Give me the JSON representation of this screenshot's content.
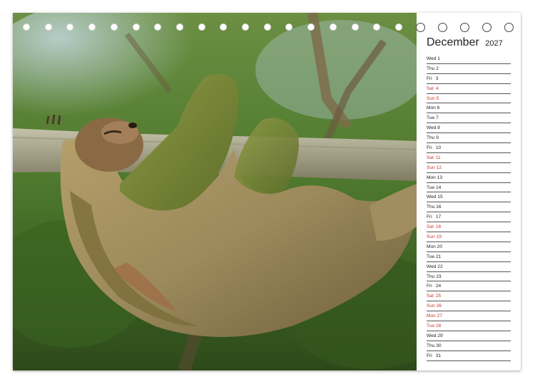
{
  "calendar": {
    "month": "December",
    "year": "2027",
    "weekend_color": "#c0392b",
    "days": [
      {
        "wd": "Wed",
        "d": "1",
        "weekend": false
      },
      {
        "wd": "Thu",
        "d": "2",
        "weekend": false
      },
      {
        "wd": "Fri",
        "d": "3",
        "weekend": false
      },
      {
        "wd": "Sat",
        "d": "4",
        "weekend": true
      },
      {
        "wd": "Sun",
        "d": "5",
        "weekend": true
      },
      {
        "wd": "Mon",
        "d": "6",
        "weekend": false
      },
      {
        "wd": "Tue",
        "d": "7",
        "weekend": false
      },
      {
        "wd": "Wed",
        "d": "8",
        "weekend": false
      },
      {
        "wd": "Thu",
        "d": "9",
        "weekend": false
      },
      {
        "wd": "Fri",
        "d": "10",
        "weekend": false
      },
      {
        "wd": "Sat",
        "d": "11",
        "weekend": true
      },
      {
        "wd": "Sun",
        "d": "12",
        "weekend": true
      },
      {
        "wd": "Mon",
        "d": "13",
        "weekend": false
      },
      {
        "wd": "Tue",
        "d": "14",
        "weekend": false
      },
      {
        "wd": "Wed",
        "d": "15",
        "weekend": false
      },
      {
        "wd": "Thu",
        "d": "16",
        "weekend": false
      },
      {
        "wd": "Fri",
        "d": "17",
        "weekend": false
      },
      {
        "wd": "Sat",
        "d": "18",
        "weekend": true
      },
      {
        "wd": "Sun",
        "d": "19",
        "weekend": true
      },
      {
        "wd": "Mon",
        "d": "20",
        "weekend": false
      },
      {
        "wd": "Tue",
        "d": "21",
        "weekend": false
      },
      {
        "wd": "Wed",
        "d": "22",
        "weekend": false
      },
      {
        "wd": "Thu",
        "d": "23",
        "weekend": false
      },
      {
        "wd": "Fri",
        "d": "24",
        "weekend": false
      },
      {
        "wd": "Sat",
        "d": "25",
        "weekend": true
      },
      {
        "wd": "Sun",
        "d": "26",
        "weekend": true
      },
      {
        "wd": "Mon",
        "d": "27",
        "weekend": true
      },
      {
        "wd": "Tue",
        "d": "28",
        "weekend": true
      },
      {
        "wd": "Wed",
        "d": "29",
        "weekend": false
      },
      {
        "wd": "Thu",
        "d": "30",
        "weekend": false
      },
      {
        "wd": "Fri",
        "d": "31",
        "weekend": false
      }
    ]
  },
  "binding": {
    "photo_rings": 19,
    "panel_rings": 5
  },
  "photo": {
    "icon": "sloth-photo",
    "foliage_color": "#4f7a2e",
    "sky_color": "#b9cfe0",
    "branch_color": "#a8a48a",
    "fur_color": "#9c8a5c",
    "moss_color": "#7d8a3a"
  }
}
